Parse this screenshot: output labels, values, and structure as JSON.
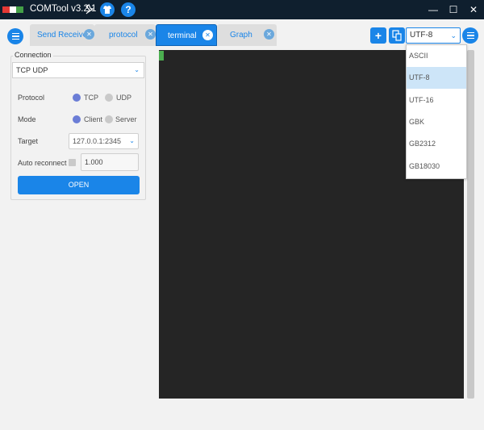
{
  "titlebar": {
    "app_title": "COMTool v3.2.1",
    "buttons": {
      "minimize": "—",
      "maximize": "☐",
      "close": "✕",
      "help": "?"
    }
  },
  "tabs": [
    {
      "label": "Send Receive",
      "active": false
    },
    {
      "label": "protocol",
      "active": false
    },
    {
      "label": "terminal",
      "active": true
    },
    {
      "label": "Graph",
      "active": false
    }
  ],
  "toolbar": {
    "add_label": "+",
    "encoding_value": "UTF-8"
  },
  "encoding_options": [
    "ASCII",
    "UTF-8",
    "UTF-16",
    "GBK",
    "GB2312",
    "GB18030"
  ],
  "encoding_selected": "UTF-8",
  "connection": {
    "group_title": "Connection",
    "type_value": "TCP UDP",
    "protocol_label": "Protocol",
    "protocol_options": [
      "TCP",
      "UDP"
    ],
    "protocol_selected": "TCP",
    "mode_label": "Mode",
    "mode_options": [
      "Client",
      "Server"
    ],
    "mode_selected": "Client",
    "target_label": "Target",
    "target_value": "127.0.0.1:2345",
    "auto_reconnect_label": "Auto reconnect",
    "auto_reconnect_checked": false,
    "reconnect_interval": "1.000",
    "open_label": "OPEN"
  },
  "colors": {
    "accent": "#1a85e8",
    "title_bar": "#0f1f2e",
    "terminal_bg": "#252525",
    "cursor": "#4caf50"
  }
}
